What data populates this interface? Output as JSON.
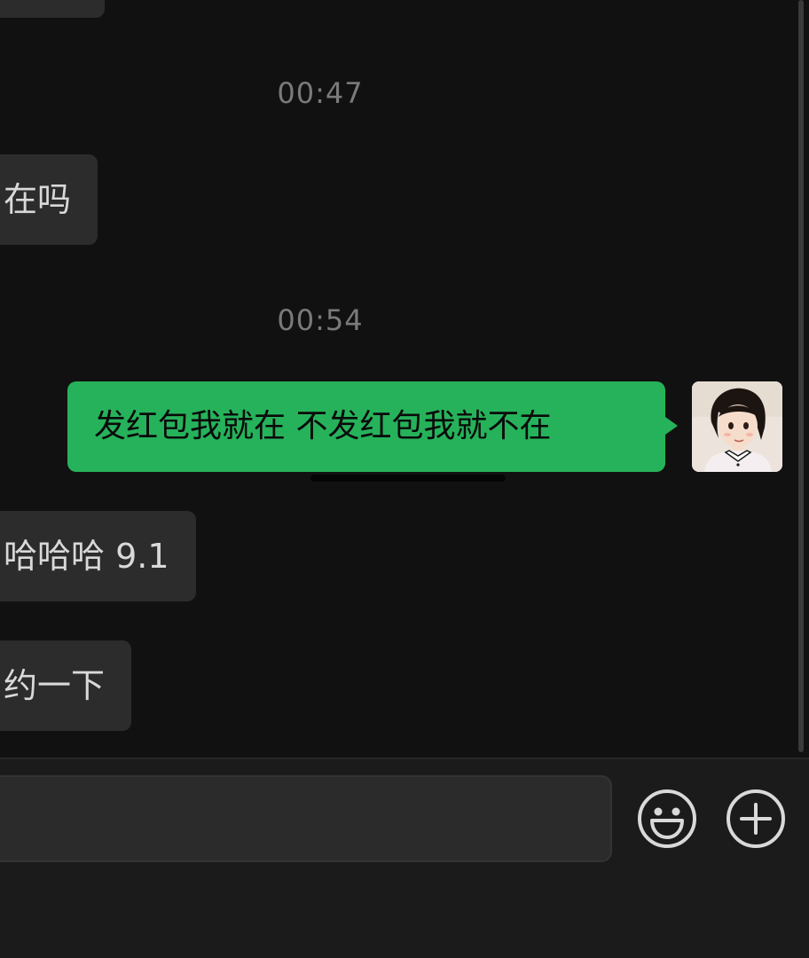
{
  "messages": {
    "incoming_1": "在吗",
    "time_1": "00:47",
    "time_2": "00:54",
    "outgoing_1": "发红包我就在 不发红包我就不在",
    "incoming_2": "哈哈哈 9.1",
    "incoming_3": "约一下"
  },
  "input": {
    "value": ""
  },
  "icons": {
    "emoji": "smiley-icon",
    "plus": "plus-circle-icon"
  },
  "colors": {
    "background": "#111111",
    "incoming_bubble": "#2c2c2c",
    "outgoing_bubble": "#26b25a",
    "timestamp_text": "#7a7a7a",
    "input_bar": "#1b1b1b"
  }
}
